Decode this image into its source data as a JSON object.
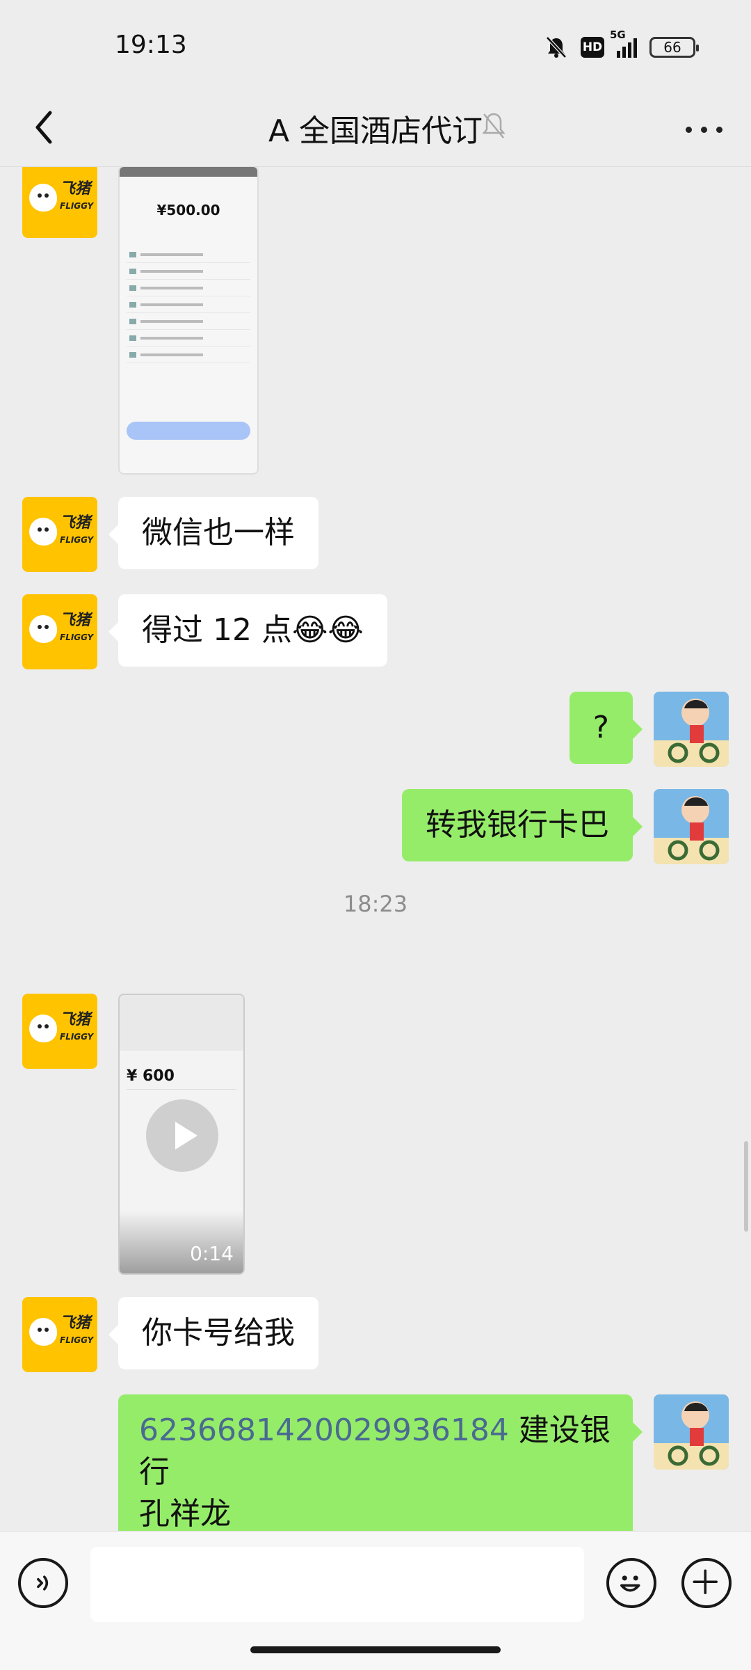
{
  "status_bar": {
    "time": "19:13",
    "hd": "HD",
    "network": "5G",
    "battery": "66",
    "icons": [
      "mute-bell-icon",
      "hd-icon",
      "signal-5g-icon",
      "battery-icon"
    ]
  },
  "header": {
    "title": "A 全国酒店代订",
    "back_icon": "chevron-left-icon",
    "mute_icon": "bell-off-icon",
    "more_icon": "more-dots-icon"
  },
  "contact_avatar_brand": {
    "text": "飞猪",
    "sub": "FLIGGY",
    "color": "#ffc300"
  },
  "messages": [
    {
      "side": "in",
      "type": "image",
      "image_text": "¥500.00"
    },
    {
      "side": "in",
      "type": "text",
      "text": "微信也一样"
    },
    {
      "side": "in",
      "type": "text",
      "text": "得过 12 点😂😂"
    },
    {
      "side": "out",
      "type": "text",
      "text": "?"
    },
    {
      "side": "out",
      "type": "text",
      "text": "转我银行卡巴"
    },
    {
      "type": "timestamp",
      "text": "18:23"
    },
    {
      "side": "in",
      "type": "video",
      "amount": "¥ 600",
      "duration": "0:14"
    },
    {
      "side": "in",
      "type": "text",
      "text": "你卡号给我"
    },
    {
      "side": "out",
      "type": "text",
      "number": "6236681420029936184",
      "text_rest": " 建设银行",
      "text_line2": "孔祥龙"
    }
  ],
  "input_bar": {
    "voice_icon": "voice-icon",
    "emoji_icon": "emoji-icon",
    "plus_icon": "plus-icon",
    "placeholder": ""
  },
  "colors": {
    "background": "#ededed",
    "outgoing_bubble": "#95ec69",
    "incoming_bubble": "#ffffff",
    "link_number": "#4a6a91"
  }
}
